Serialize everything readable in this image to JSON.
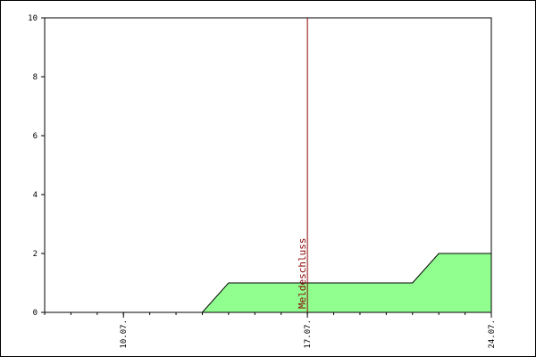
{
  "chart_data": {
    "type": "area",
    "title": "",
    "xlabel": "",
    "ylabel": "",
    "ylim": [
      0,
      10
    ],
    "y_ticks": [
      0,
      2,
      4,
      6,
      8,
      10
    ],
    "x_domain": [
      "2000-07-07",
      "2000-07-24"
    ],
    "x_ticks": [
      {
        "date": "2000-07-10",
        "label": "10.07."
      },
      {
        "date": "2000-07-17",
        "label": "17.07."
      },
      {
        "date": "2000-07-24",
        "label": "24.07."
      }
    ],
    "grid": false,
    "series": [
      {
        "x": [
          "2000-07-07",
          "2000-07-13",
          "2000-07-14",
          "2000-07-21",
          "2000-07-22",
          "2000-07-24"
        ],
        "values": [
          0,
          0,
          1,
          1,
          2,
          2
        ],
        "fill_color": "#90FF90",
        "line_color": "#000000"
      }
    ],
    "annotations": [
      {
        "x": "2000-07-17",
        "label": "Meldeschluss",
        "color": "#8B0000"
      }
    ]
  }
}
